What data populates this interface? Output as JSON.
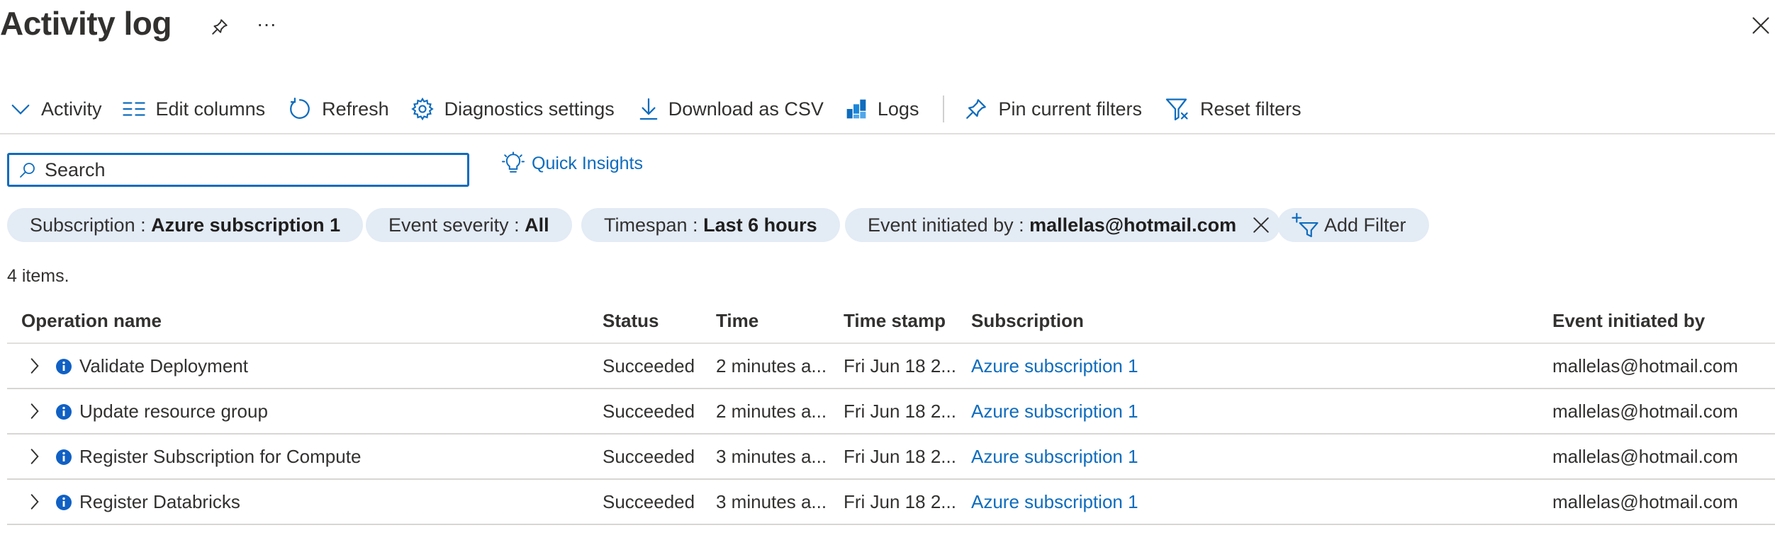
{
  "header": {
    "title": "Activity log",
    "more_label": "···"
  },
  "toolbar": {
    "items": [
      {
        "label": "Activity",
        "icon": "chevron-down-icon"
      },
      {
        "label": "Edit columns",
        "icon": "columns-icon"
      },
      {
        "label": "Refresh",
        "icon": "refresh-icon"
      },
      {
        "label": "Diagnostics settings",
        "icon": "gear-icon"
      },
      {
        "label": "Download as CSV",
        "icon": "download-icon"
      },
      {
        "label": "Logs",
        "icon": "logs-icon"
      },
      {
        "label": "Pin current filters",
        "icon": "pin-icon"
      },
      {
        "label": "Reset filters",
        "icon": "filter-reset-icon"
      }
    ]
  },
  "search": {
    "placeholder": "Search",
    "value": ""
  },
  "quick_insights": {
    "label": "Quick Insights",
    "icon": "lightbulb-icon"
  },
  "filters": [
    {
      "key": "Subscription :",
      "value": "Azure subscription 1",
      "removable": false
    },
    {
      "key": "Event severity :",
      "value": "All",
      "removable": false
    },
    {
      "key": "Timespan :",
      "value": "Last 6 hours",
      "removable": false
    },
    {
      "key": "Event initiated by :",
      "value": "mallelas@hotmail.com",
      "removable": true
    }
  ],
  "add_filter": {
    "label": "Add Filter",
    "icon": "add-filter-icon"
  },
  "items_count": "4 items.",
  "table": {
    "columns": [
      "Operation name",
      "Status",
      "Time",
      "Time stamp",
      "Subscription",
      "Event initiated by"
    ],
    "rows": [
      {
        "operation": "Validate Deployment",
        "status": "Succeeded",
        "time": "2 minutes a...",
        "timestamp": "Fri Jun 18 2...",
        "subscription": "Azure subscription 1",
        "initiated_by": "mallelas@hotmail.com"
      },
      {
        "operation": "Update resource group",
        "status": "Succeeded",
        "time": "2 minutes a...",
        "timestamp": "Fri Jun 18 2...",
        "subscription": "Azure subscription 1",
        "initiated_by": "mallelas@hotmail.com"
      },
      {
        "operation": "Register Subscription for Compute",
        "status": "Succeeded",
        "time": "3 minutes a...",
        "timestamp": "Fri Jun 18 2...",
        "subscription": "Azure subscription 1",
        "initiated_by": "mallelas@hotmail.com"
      },
      {
        "operation": "Register Databricks",
        "status": "Succeeded",
        "time": "3 minutes a...",
        "timestamp": "Fri Jun 18 2...",
        "subscription": "Azure subscription 1",
        "initiated_by": "mallelas@hotmail.com"
      }
    ]
  },
  "colors": {
    "accent": "#0f6cbd",
    "pill_bg": "#e3ebf5",
    "text": "#323130",
    "info": "#1060c4"
  }
}
